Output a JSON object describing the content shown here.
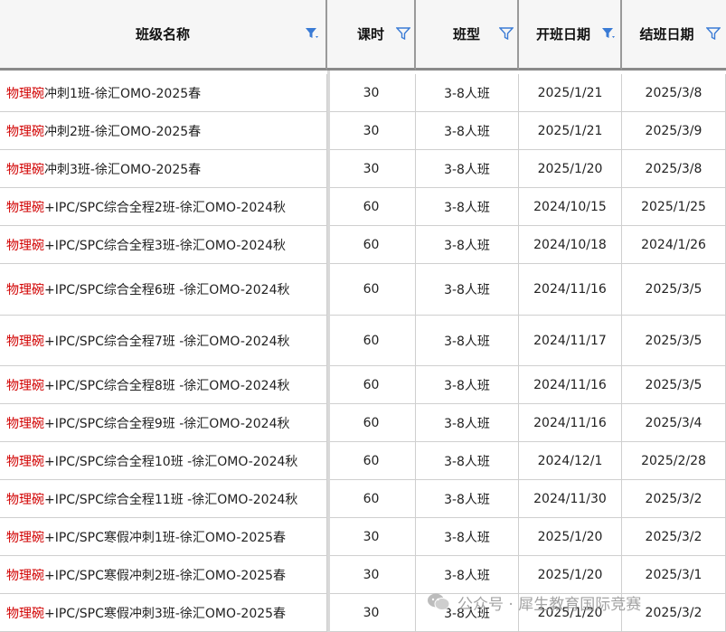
{
  "columns": [
    {
      "label": "班级名称",
      "filter_active": true
    },
    {
      "label": "课时",
      "filter_active": false
    },
    {
      "label": "班型",
      "filter_active": false
    },
    {
      "label": "开班日期",
      "filter_active": true
    },
    {
      "label": "结班日期",
      "filter_active": false
    }
  ],
  "colors": {
    "highlight_prefix": "#d10000",
    "filter_icon": "#3a7bd5"
  },
  "rows": [
    {
      "prefix": "物理碗",
      "suffix": "冲刺1班-徐汇OMO-2025春",
      "hours": "30",
      "type": "3-8人班",
      "start": "2025/1/21",
      "end": "2025/3/8"
    },
    {
      "prefix": "物理碗",
      "suffix": "冲刺2班-徐汇OMO-2025春",
      "hours": "30",
      "type": "3-8人班",
      "start": "2025/1/21",
      "end": "2025/3/9"
    },
    {
      "prefix": "物理碗",
      "suffix": "冲刺3班-徐汇OMO-2025春",
      "hours": "30",
      "type": "3-8人班",
      "start": "2025/1/20",
      "end": "2025/3/8"
    },
    {
      "prefix": "物理碗",
      "suffix": "+IPC/SPC综合全程2班-徐汇OMO-2024秋",
      "hours": "60",
      "type": "3-8人班",
      "start": "2024/10/15",
      "end": "2025/1/25"
    },
    {
      "prefix": "物理碗",
      "suffix": "+IPC/SPC综合全程3班-徐汇OMO-2024秋",
      "hours": "60",
      "type": "3-8人班",
      "start": "2024/10/18",
      "end": "2024/1/26"
    },
    {
      "prefix": "物理碗",
      "suffix": "+IPC/SPC综合全程6班 -徐汇OMO-2024秋",
      "hours": "60",
      "type": "3-8人班",
      "start": "2024/11/16",
      "end": "2025/3/5"
    },
    {
      "prefix": "物理碗",
      "suffix": "+IPC/SPC综合全程7班 -徐汇OMO-2024秋",
      "hours": "60",
      "type": "3-8人班",
      "start": "2024/11/17",
      "end": "2025/3/5"
    },
    {
      "prefix": "物理碗",
      "suffix": "+IPC/SPC综合全程8班 -徐汇OMO-2024秋",
      "hours": "60",
      "type": "3-8人班",
      "start": "2024/11/16",
      "end": "2025/3/5"
    },
    {
      "prefix": "物理碗",
      "suffix": "+IPC/SPC综合全程9班 -徐汇OMO-2024秋",
      "hours": "60",
      "type": "3-8人班",
      "start": "2024/11/16",
      "end": "2025/3/4"
    },
    {
      "prefix": "物理碗",
      "suffix": "+IPC/SPC综合全程10班 -徐汇OMO-2024秋",
      "hours": "60",
      "type": "3-8人班",
      "start": "2024/12/1",
      "end": "2025/2/28"
    },
    {
      "prefix": "物理碗",
      "suffix": "+IPC/SPC综合全程11班 -徐汇OMO-2024秋",
      "hours": "60",
      "type": "3-8人班",
      "start": "2024/11/30",
      "end": "2025/3/2"
    },
    {
      "prefix": "物理碗",
      "suffix": "+IPC/SPC寒假冲刺1班-徐汇OMO-2025春",
      "hours": "30",
      "type": "3-8人班",
      "start": "2025/1/20",
      "end": "2025/3/2"
    },
    {
      "prefix": "物理碗",
      "suffix": "+IPC/SPC寒假冲刺2班-徐汇OMO-2025春",
      "hours": "30",
      "type": "3-8人班",
      "start": "2025/1/20",
      "end": "2025/3/1"
    },
    {
      "prefix": "物理碗",
      "suffix": "+IPC/SPC寒假冲刺3班-徐汇OMO-2025春",
      "hours": "30",
      "type": "3-8人班",
      "start": "2025/1/20",
      "end": "2025/3/2"
    }
  ],
  "watermark": {
    "icon": "wechat-icon",
    "text": "公众号 · 犀生教育国际竞赛"
  }
}
